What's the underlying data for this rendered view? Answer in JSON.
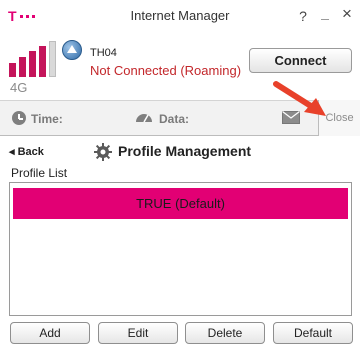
{
  "window": {
    "title": "Internet Manager",
    "help_label": "?",
    "minimize_label": "_",
    "close_label": "×"
  },
  "brand": {
    "logo_letter": "T"
  },
  "status": {
    "network_type": "4G",
    "operator": "TH04",
    "connection_status": "Not Connected (Roaming)",
    "connect_label": "Connect",
    "signal_bars": [
      {
        "color": "#c4145a"
      },
      {
        "color": "#c4145a"
      },
      {
        "color": "#c4145a"
      },
      {
        "color": "#c4145a"
      },
      {
        "color": "#d9d9d9"
      }
    ]
  },
  "info": {
    "time_label": "Time:",
    "data_label": "Data:",
    "close_label": "Close"
  },
  "profile": {
    "back_label": "◂ Back",
    "title": "Profile Management",
    "list_label": "Profile List",
    "items": [
      {
        "name": "TRUE (Default)",
        "selected": true
      }
    ]
  },
  "buttons": {
    "add": "Add",
    "edit": "Edit",
    "delete": "Delete",
    "default": "Default"
  },
  "colors": {
    "brand": "#e20074",
    "status_error": "#c3272b",
    "annotation_arrow": "#e8412a"
  }
}
